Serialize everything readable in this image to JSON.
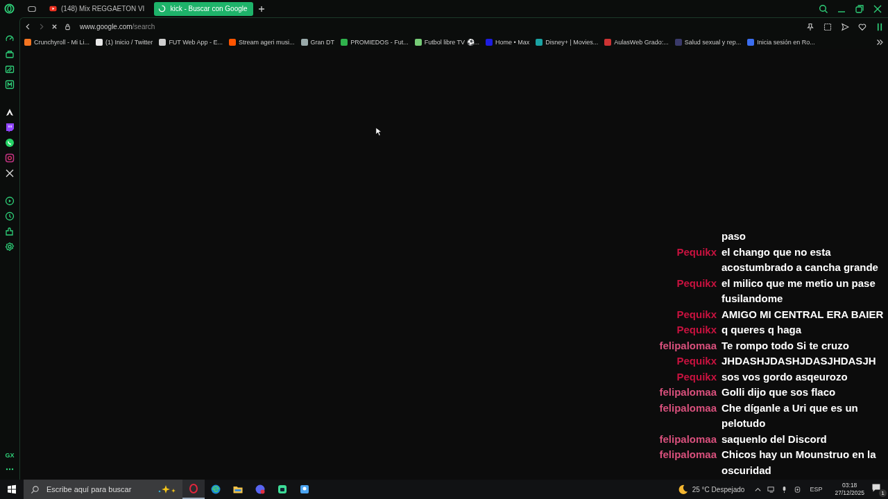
{
  "tabs": [
    {
      "label": "(148) Mix REGGAETON VI",
      "selected": false
    },
    {
      "label": "kick - Buscar con Google",
      "selected": true
    }
  ],
  "address_bar": {
    "host": "www.google.com",
    "path": "/search",
    "loading": true
  },
  "bookmarks": [
    {
      "label": "Crunchyroll - Mi Li..."
    },
    {
      "label": "(1) Inicio / Twitter"
    },
    {
      "label": "FUT Web App - E..."
    },
    {
      "label": "Stream ageri musi..."
    },
    {
      "label": "Gran DT"
    },
    {
      "label": "PROMIEDOS - Fut..."
    },
    {
      "label": "Futbol libre TV ⚽..."
    },
    {
      "label": "Home • Max"
    },
    {
      "label": "Disney+ | Movies..."
    },
    {
      "label": "AulasWeb Grado:..."
    },
    {
      "label": "Salud sexual y rep..."
    },
    {
      "label": "Inicia sesión en Ro..."
    }
  ],
  "sidebar": {
    "bottom_label": "GX"
  },
  "chat": [
    {
      "text": "paso"
    },
    {
      "user": "Pequikx",
      "color": "#c8123f",
      "text": "el chango que no esta acostumbrado a cancha grande"
    },
    {
      "user": "Pequikx",
      "color": "#c8123f",
      "text": "el milico que me metio un pase fusilandome"
    },
    {
      "user": "Pequikx",
      "color": "#c8123f",
      "text": "AMIGO MI CENTRAL ERA BAIER"
    },
    {
      "user": "Pequikx",
      "color": "#c8123f",
      "text": "q queres q haga"
    },
    {
      "user": "felipalomaa",
      "color": "#d8507c",
      "text": "Te rompo todo Si te cruzo"
    },
    {
      "user": "Pequikx",
      "color": "#c8123f",
      "text": "JHDASHJDASHJDASJHDASJH"
    },
    {
      "user": "Pequikx",
      "color": "#c8123f",
      "text": "sos vos gordo asqeurozo"
    },
    {
      "user": "felipalomaa",
      "color": "#d8507c",
      "text": "Golli dijo que sos flaco"
    },
    {
      "user": "felipalomaa",
      "color": "#d8507c",
      "text": "Che díganle a Uri que es un pelotudo"
    },
    {
      "user": "felipalomaa",
      "color": "#d8507c",
      "text": "saquenlo del Discord"
    },
    {
      "user": "felipalomaa",
      "color": "#d8507c",
      "text": "Chicos hay un Mounstruo en la oscuridad"
    }
  ],
  "taskbar": {
    "search_placeholder": "Escribe aquí para buscar",
    "weather": "25 °C Despejado",
    "language": "ESP",
    "time": "03:18",
    "date": "27/12/2025",
    "notifications": "1"
  }
}
